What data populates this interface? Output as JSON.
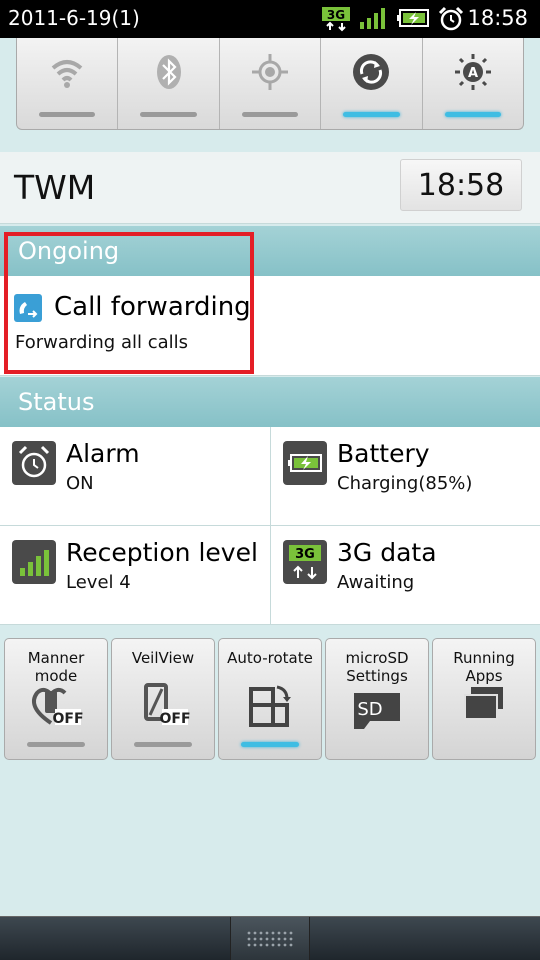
{
  "status_bar": {
    "date": "2011-6-19(1)",
    "time": "18:58",
    "icons": [
      "3g-icon",
      "signal-icon",
      "battery-charging-icon",
      "alarm-icon"
    ],
    "network_label": "3G"
  },
  "quick_toggles": [
    {
      "name": "wifi",
      "icon": "wifi-icon",
      "on": false
    },
    {
      "name": "bluetooth",
      "icon": "bluetooth-icon",
      "on": false
    },
    {
      "name": "gps",
      "icon": "gps-icon",
      "on": false
    },
    {
      "name": "sync",
      "icon": "sync-icon",
      "on": true
    },
    {
      "name": "auto-brightness",
      "icon": "brightness-auto-icon",
      "on": true
    }
  ],
  "carrier": {
    "name": "TWM",
    "time": "18:58"
  },
  "ongoing": {
    "header": "Ongoing",
    "item": {
      "title": "Call forwarding",
      "subtitle": "Forwarding all calls",
      "icon": "call-forward-icon"
    }
  },
  "status": {
    "header": "Status",
    "items": [
      {
        "name": "Alarm",
        "value": "ON",
        "icon": "alarm-icon"
      },
      {
        "name": "Battery",
        "value": "Charging(85%)",
        "icon": "battery-icon"
      },
      {
        "name": "Reception level",
        "value": "Level 4",
        "icon": "signal-icon"
      },
      {
        "name": "3G data",
        "value": "Awaiting",
        "icon": "3g-data-icon",
        "badge": "3G"
      }
    ]
  },
  "tiles": [
    {
      "label": "Manner mode",
      "icon": "manner-mode-icon",
      "state_text": "OFF",
      "on": false
    },
    {
      "label": "VeilView",
      "icon": "veilview-icon",
      "state_text": "OFF",
      "on": false
    },
    {
      "label": "Auto-rotate",
      "icon": "auto-rotate-icon",
      "on": true
    },
    {
      "label": "microSD Settings",
      "icon": "microsd-icon",
      "badge": "SD"
    },
    {
      "label": "Running Apps",
      "icon": "running-apps-icon"
    }
  ],
  "colors": {
    "accent": "#3fbde3",
    "header": "#8fc6cb",
    "highlight": "#e41e26",
    "signal": "#7ac23a"
  }
}
